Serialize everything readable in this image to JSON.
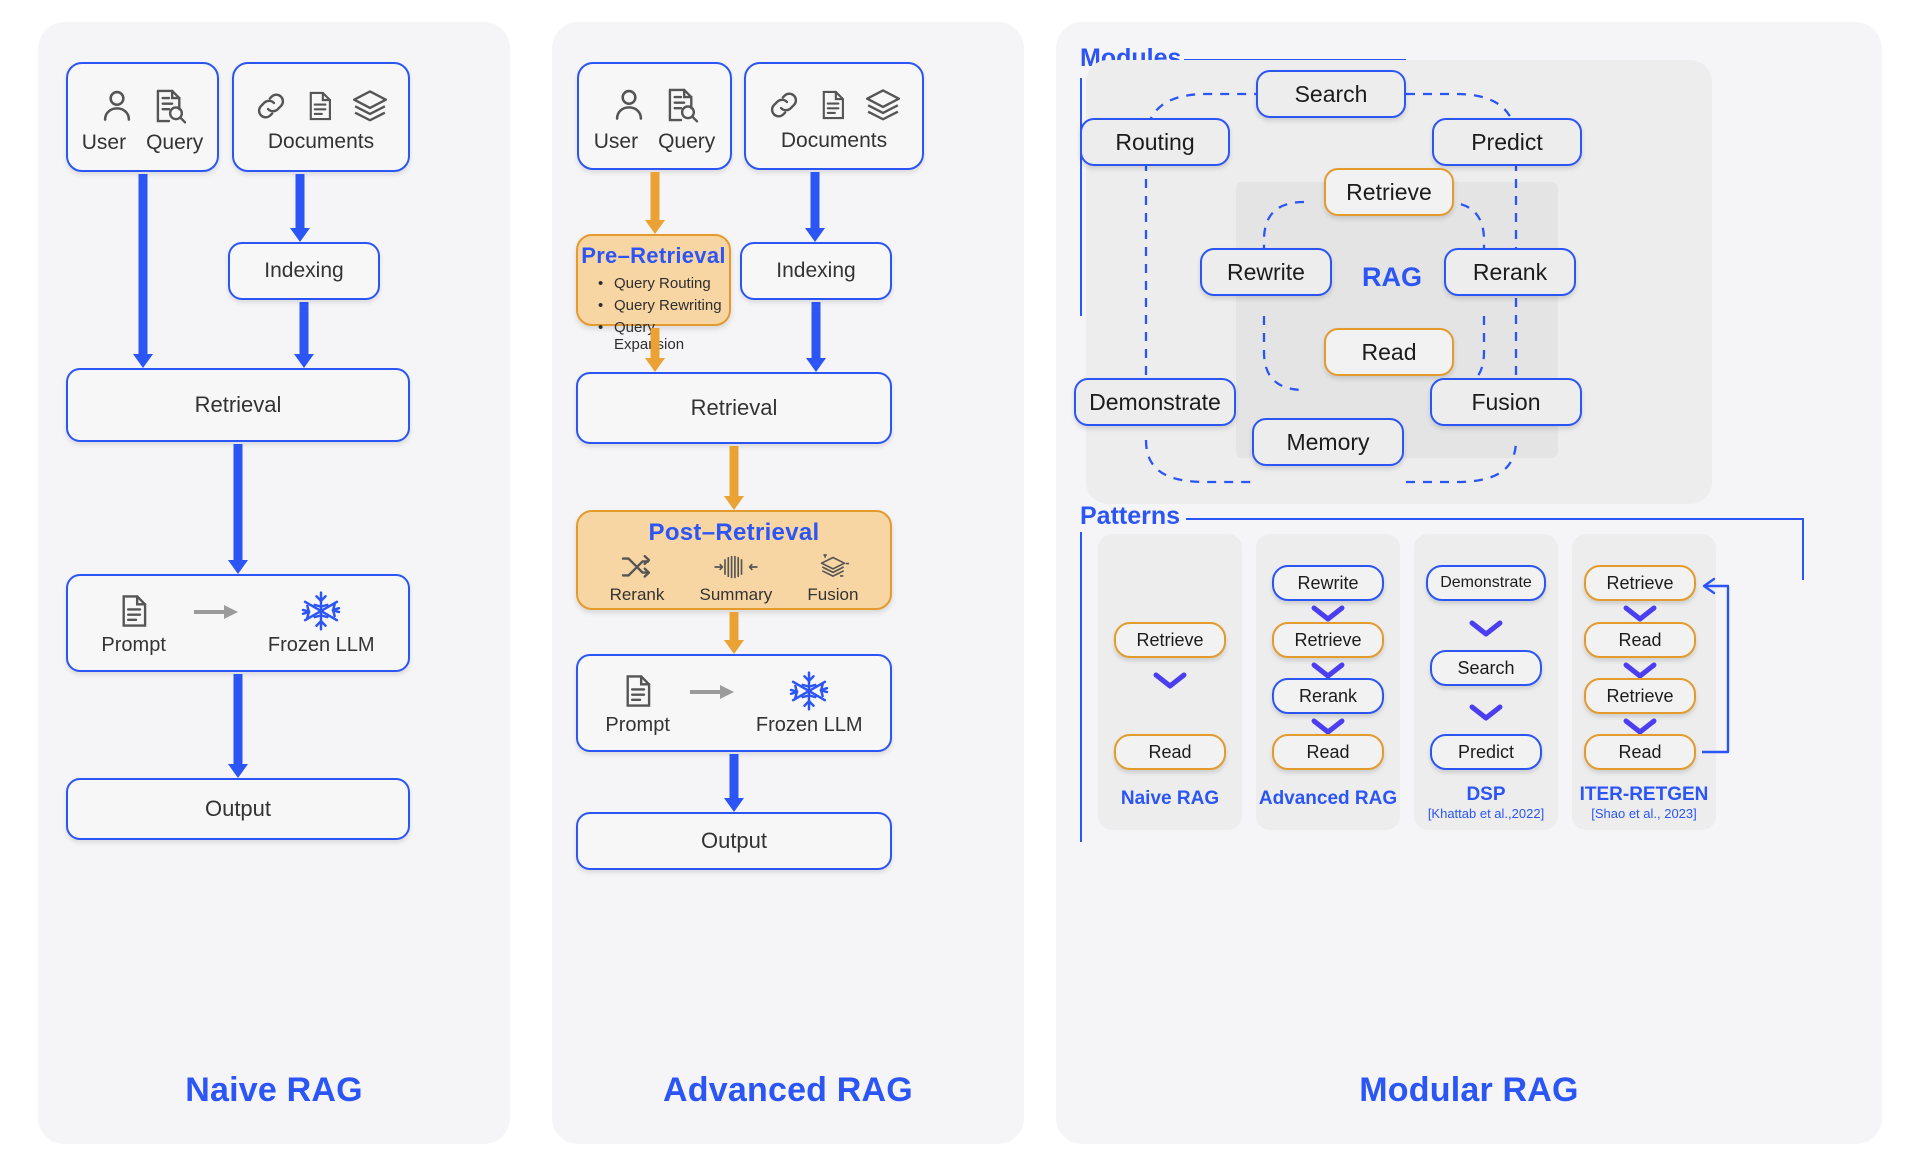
{
  "columns": {
    "naive": {
      "title": "Naive RAG",
      "sources": {
        "left": {
          "icons": [
            "user-icon",
            "query-doc-search-icon"
          ],
          "labels": [
            "User",
            "Query"
          ]
        },
        "right": {
          "icons": [
            "link-icon",
            "document-icon",
            "layers-icon"
          ],
          "labels": [
            "Documents"
          ]
        }
      },
      "indexing": "Indexing",
      "retrieval": "Retrieval",
      "generation": {
        "prompt": "Prompt",
        "llm": "Frozen LLM",
        "arrow_icon": "right-arrow-icon",
        "snowflake_icon": "snowflake-icon"
      },
      "output": "Output"
    },
    "advanced": {
      "title": "Advanced RAG",
      "sources": {
        "left": {
          "icons": [
            "user-icon",
            "query-doc-search-icon"
          ],
          "labels": [
            "User",
            "Query"
          ]
        },
        "right": {
          "icons": [
            "link-icon",
            "document-icon",
            "layers-icon"
          ],
          "labels": [
            "Documents"
          ]
        }
      },
      "pre_retrieval": {
        "title": "Pre–Retrieval",
        "items": [
          "Query Routing",
          "Query Rewriting",
          "Query Expansion"
        ]
      },
      "indexing": "Indexing",
      "retrieval": "Retrieval",
      "post_retrieval": {
        "title": "Post–Retrieval",
        "items": [
          {
            "label": "Rerank",
            "icon": "shuffle-icon"
          },
          {
            "label": "Summary",
            "icon": "compress-icon"
          },
          {
            "label": "Fusion",
            "icon": "layers-merge-icon"
          }
        ]
      },
      "generation": {
        "prompt": "Prompt",
        "llm": "Frozen LLM",
        "arrow_icon": "right-arrow-icon",
        "snowflake_icon": "snowflake-icon"
      },
      "output": "Output"
    },
    "modular": {
      "title": "Modular RAG",
      "modules_label": "Modules",
      "patterns_label": "Patterns",
      "modules": {
        "center": "RAG",
        "outer": [
          "Search",
          "Routing",
          "Predict",
          "Demonstrate",
          "Fusion",
          "Memory"
        ],
        "inner": [
          "Retrieve",
          "Rewrite",
          "Rerank",
          "Read"
        ]
      },
      "patterns": [
        {
          "caption": "Naive RAG",
          "cite": "",
          "steps": [
            {
              "label": "Retrieve",
              "color": "orange"
            },
            {
              "label": "Read",
              "color": "orange"
            }
          ],
          "loop": false
        },
        {
          "caption": "Advanced RAG",
          "cite": "",
          "steps": [
            {
              "label": "Rewrite",
              "color": "blue"
            },
            {
              "label": "Retrieve",
              "color": "orange"
            },
            {
              "label": "Rerank",
              "color": "blue"
            },
            {
              "label": "Read",
              "color": "orange"
            }
          ],
          "loop": false
        },
        {
          "caption": "DSP",
          "cite": "[Khattab et al.,2022]",
          "steps": [
            {
              "label": "Demonstrate",
              "color": "blue"
            },
            {
              "label": "Search",
              "color": "blue"
            },
            {
              "label": "Predict",
              "color": "blue"
            }
          ],
          "loop": false
        },
        {
          "caption": "ITER-RETGEN",
          "cite": "[Shao et al., 2023]",
          "steps": [
            {
              "label": "Retrieve",
              "color": "orange"
            },
            {
              "label": "Read",
              "color": "orange"
            },
            {
              "label": "Retrieve",
              "color": "orange"
            },
            {
              "label": "Read",
              "color": "orange"
            }
          ],
          "loop": true
        }
      ]
    }
  },
  "colors": {
    "blue": "#2b55f5",
    "orange_border": "#e39b2e",
    "orange_fill": "#f8d6a4",
    "orange_arrow": "#e9a233",
    "panel_bg": "#f5f5f7",
    "node_bg": "#f7f7f8",
    "text": "#333333"
  }
}
